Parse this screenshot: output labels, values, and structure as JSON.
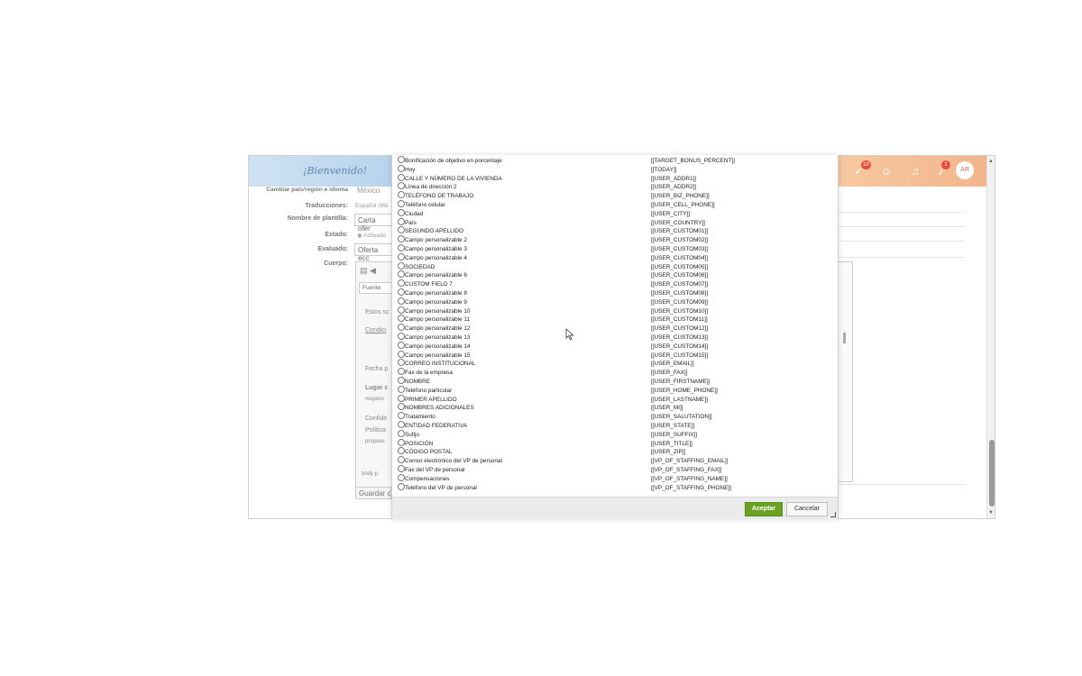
{
  "header": {
    "welcome": "¡Bienvenido!",
    "badge_checks": "10",
    "badge_alerts": "1",
    "avatar_initials": "AR"
  },
  "form": {
    "region_label": "Cambiar país/región e idioma",
    "region_value": "México",
    "translations_label": "Traducciones:",
    "translations_value": "Español (Mé",
    "template_name_label": "Nombre de plantilla:",
    "template_name_value": "Carta ofer",
    "status_label": "Estado:",
    "status_value": "Activado",
    "evaluated_label": "Evaluado:",
    "evaluated_value": "Oferta ecc",
    "body_label": "Cuerpo:",
    "font_value": "Fuente",
    "editor_lines": [
      "Estos sc",
      "Condici",
      "Fecha p",
      "Lugar c",
      "respons",
      "Confide",
      "Política",
      "propues"
    ],
    "editor_status": "body  p",
    "save_label": "Guardar c"
  },
  "dialog": {
    "options": [
      {
        "label": "Bonificación de objetivo en porcentaje",
        "token": "[[TARGET_BONUS_PERCENT]]"
      },
      {
        "label": "Hoy",
        "token": "[[TODAY]]"
      },
      {
        "label": "CALLE Y NÚMERO DE LA VIVIENDA",
        "token": "[[USER_ADDR1]]"
      },
      {
        "label": "Línea de dirección 2",
        "token": "[[USER_ADDR2]]"
      },
      {
        "label": "TELÉFONO DE TRABAJO",
        "token": "[[USER_BIZ_PHONE]]"
      },
      {
        "label": "Teléfono celular",
        "token": "[[USER_CELL_PHONE]]"
      },
      {
        "label": "Ciudad",
        "token": "[[USER_CITY]]"
      },
      {
        "label": "País",
        "token": "[[USER_COUNTRY]]"
      },
      {
        "label": "SEGUNDO APELLIDO",
        "token": "[[USER_CUSTOM01]]"
      },
      {
        "label": "Campo personalizable 2",
        "token": "[[USER_CUSTOM02]]"
      },
      {
        "label": "Campo personalizable 3",
        "token": "[[USER_CUSTOM03]]"
      },
      {
        "label": "Campo personalizable 4",
        "token": "[[USER_CUSTOM04]]"
      },
      {
        "label": "SOCIEDAD",
        "token": "[[USER_CUSTOM05]]"
      },
      {
        "label": "Campo personalizable 6",
        "token": "[[USER_CUSTOM06]]"
      },
      {
        "label": "CUSTOM FIELD 7",
        "token": "[[USER_CUSTOM07]]"
      },
      {
        "label": "Campo personalizable 8",
        "token": "[[USER_CUSTOM08]]"
      },
      {
        "label": "Campo personalizable 9",
        "token": "[[USER_CUSTOM09]]"
      },
      {
        "label": "Campo personalizable 10",
        "token": "[[USER_CUSTOM10]]"
      },
      {
        "label": "Campo personalizable 11",
        "token": "[[USER_CUSTOM11]]"
      },
      {
        "label": "Campo personalizable 12",
        "token": "[[USER_CUSTOM12]]"
      },
      {
        "label": "Campo personalizable 13",
        "token": "[[USER_CUSTOM13]]"
      },
      {
        "label": "Campo personalizable 14",
        "token": "[[USER_CUSTOM14]]"
      },
      {
        "label": "Campo personalizable 15",
        "token": "[[USER_CUSTOM15]]"
      },
      {
        "label": "CORREO INSTITUCIONAL",
        "token": "[[USER_EMAIL]]"
      },
      {
        "label": "Fax de la empresa",
        "token": "[[USER_FAX]]"
      },
      {
        "label": "NOMBRE",
        "token": "[[USER_FIRSTNAME]]"
      },
      {
        "label": "Teléfono particular",
        "token": "[[USER_HOME_PHONE]]"
      },
      {
        "label": "PRIMER APELLIDO",
        "token": "[[USER_LASTNAME]]"
      },
      {
        "label": "NOMBRES ADICIONALES",
        "token": "[[USER_MI]]"
      },
      {
        "label": "Tratamiento",
        "token": "[[USER_SALUTATION]]"
      },
      {
        "label": "ENTIDAD FEDERATIVA",
        "token": "[[USER_STATE]]"
      },
      {
        "label": "Sufijo",
        "token": "[[USER_SUFFIX]]"
      },
      {
        "label": "POSICIÓN",
        "token": "[[USER_TITLE]]"
      },
      {
        "label": "CÓDIGO POSTAL",
        "token": "[[USER_ZIP]]"
      },
      {
        "label": "Correo electrónico del VP de personal",
        "token": "[[VP_OF_STAFFING_EMAIL]]"
      },
      {
        "label": "Fax del VP de personal",
        "token": "[[VP_OF_STAFFING_FAX]]"
      },
      {
        "label": "Compensaciones",
        "token": "[[VP_OF_STAFFING_NAME]]"
      },
      {
        "label": "Teléfono del VP de personal",
        "token": "[[VP_OF_STAFFING_PHONE]]"
      }
    ],
    "accept_label": "Aceptar",
    "cancel_label": "Cancelar"
  },
  "colors": {
    "accept_button": "#6aa121",
    "header_left": "#cfe2f3",
    "header_right": "#f6c9a2"
  }
}
